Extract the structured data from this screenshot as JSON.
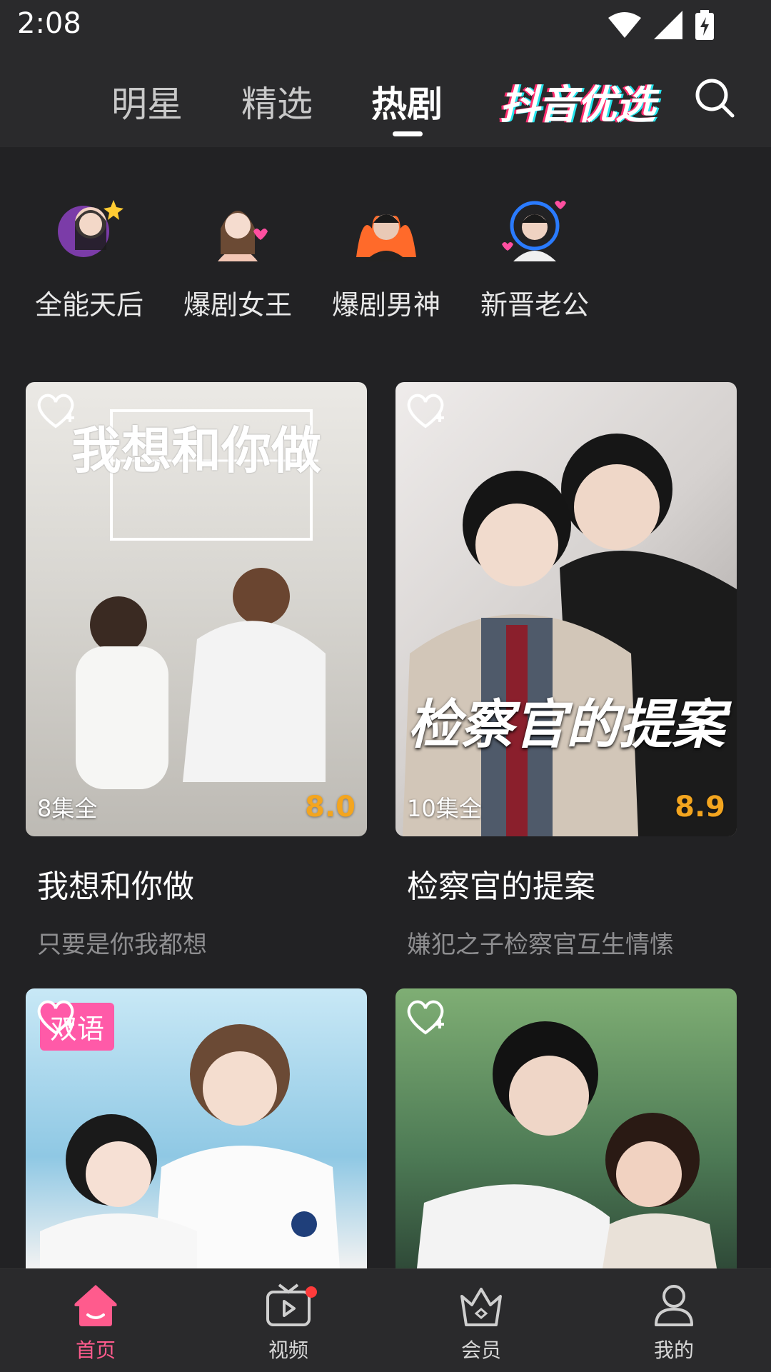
{
  "status_bar": {
    "time": "2:08"
  },
  "top_nav": {
    "tabs": [
      {
        "label": "明星"
      },
      {
        "label": "精选"
      },
      {
        "label": "热剧",
        "active": true
      }
    ],
    "brand": "抖音优选",
    "search_icon": "search-icon"
  },
  "stars": [
    {
      "label": "全能天后",
      "icon": "avatar-female"
    },
    {
      "label": "爆剧女王",
      "icon": "avatar-female"
    },
    {
      "label": "爆剧男神",
      "icon": "avatar-male"
    },
    {
      "label": "新晋老公",
      "icon": "avatar-male"
    }
  ],
  "cards": [
    {
      "poster_title": "我想和你做",
      "episodes": "8集全",
      "score": "8.0",
      "title": "我想和你做",
      "subtitle": "只要是你我都想",
      "colors": [
        "#e8e6e2",
        "#b9b7b2"
      ]
    },
    {
      "poster_title": "检察官的提案",
      "episodes": "10集全",
      "score": "8.9",
      "title": "检察官的提案",
      "subtitle": "嫌犯之子检察官互生情愫",
      "colors": [
        "#d9d6d4",
        "#7a7876"
      ]
    },
    {
      "badge": "双语",
      "colors": [
        "#b7dff2",
        "#6fb4d8"
      ]
    },
    {
      "colors": [
        "#6e9c68",
        "#3b5a43"
      ]
    }
  ],
  "bottom_nav": [
    {
      "label": "首页",
      "icon": "home-icon",
      "active": true
    },
    {
      "label": "视频",
      "icon": "video-icon",
      "dot": true
    },
    {
      "label": "会员",
      "icon": "vip-crown-icon"
    },
    {
      "label": "我的",
      "icon": "profile-icon"
    }
  ],
  "colors": {
    "accent": "#ff5b8d",
    "score": "#f3a51f",
    "background": "#222224"
  }
}
